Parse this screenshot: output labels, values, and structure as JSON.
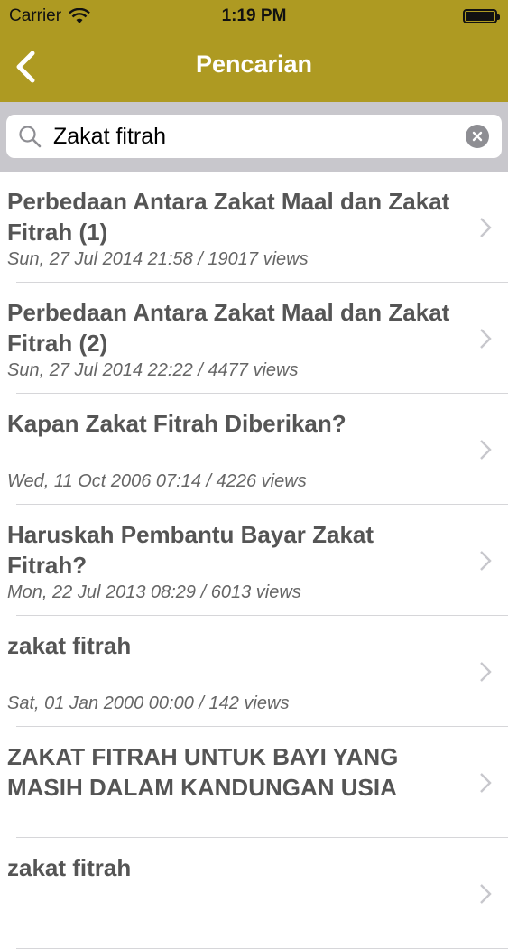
{
  "status_bar": {
    "carrier": "Carrier",
    "time": "1:19 PM"
  },
  "navbar": {
    "title": "Pencarian"
  },
  "search": {
    "value": "Zakat fitrah",
    "placeholder": ""
  },
  "results": [
    {
      "title": "Perbedaan Antara Zakat Maal dan Zakat Fitrah (1)",
      "meta": "Sun, 27 Jul 2014 21:58 / 19017 views"
    },
    {
      "title": "Perbedaan Antara Zakat Maal dan Zakat Fitrah (2)",
      "meta": "Sun, 27 Jul 2014 22:22 / 4477 views"
    },
    {
      "title": "Kapan Zakat Fitrah Diberikan?",
      "meta": "Wed, 11 Oct 2006 07:14 / 4226 views"
    },
    {
      "title": "Haruskah Pembantu Bayar Zakat Fitrah?",
      "meta": "Mon, 22 Jul 2013 08:29 / 6013 views"
    },
    {
      "title": "zakat fitrah",
      "meta": "Sat, 01 Jan 2000 00:00 / 142 views"
    },
    {
      "title": "ZAKAT FITRAH UNTUK BAYI YANG MASIH DALAM KANDUNGAN USIA",
      "meta": ""
    },
    {
      "title": "zakat fitrah",
      "meta": ""
    }
  ],
  "colors": {
    "header": "#ae9a22",
    "search_bar_bg": "#c8c7cc",
    "text": "#555555"
  }
}
